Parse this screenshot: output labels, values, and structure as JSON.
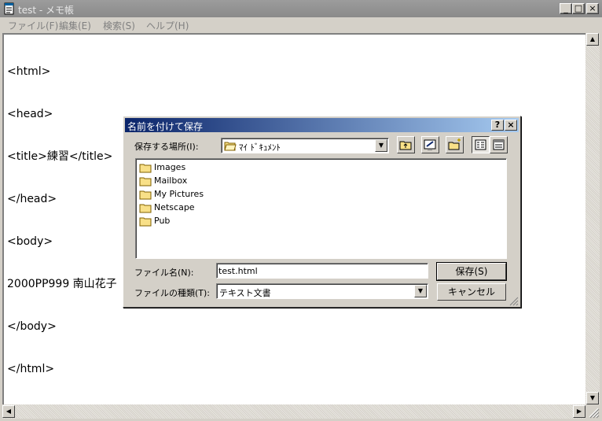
{
  "window": {
    "title": "test - メモ帳",
    "controls": {
      "minimize": "_",
      "maximize": "□",
      "close": "×"
    }
  },
  "menu": [
    "ファイル(F)",
    "編集(E)",
    "検索(S)",
    "ヘルプ(H)"
  ],
  "editor": {
    "lines": [
      "<html>",
      "<head>",
      "<title>練習</title>",
      "</head>",
      "<body>",
      "2000PP999 南山花子",
      "</body>",
      "</html>"
    ]
  },
  "dialog": {
    "title": "名前を付けて保存",
    "help": "?",
    "close": "×",
    "location_label": "保存する場所(I):",
    "location_value": "ﾏｲ ﾄﾞｷｭﾒﾝﾄ",
    "files": [
      "Images",
      "Mailbox",
      "My Pictures",
      "Netscape",
      "Pub"
    ],
    "filename_label": "ファイル名(N):",
    "filename_value": "test.html",
    "filetype_label": "ファイルの種類(T):",
    "filetype_value": "テキスト文書",
    "save_label": "保存(S)",
    "cancel_label": "キャンセル"
  },
  "colors": {
    "titlebar_inactive": "#8a8a8a",
    "dialog_title_start": "#0a246a",
    "dialog_title_end": "#a6caf0",
    "folder": "#f8e088"
  },
  "icons": [
    "notepad-icon",
    "folder-icon",
    "up-folder-icon",
    "desktop-icon",
    "new-folder-icon",
    "list-view-icon",
    "details-view-icon",
    "chevron-down-icon",
    "arrow-up-icon",
    "arrow-down-icon",
    "arrow-left-icon",
    "arrow-right-icon",
    "resize-grip-icon"
  ]
}
